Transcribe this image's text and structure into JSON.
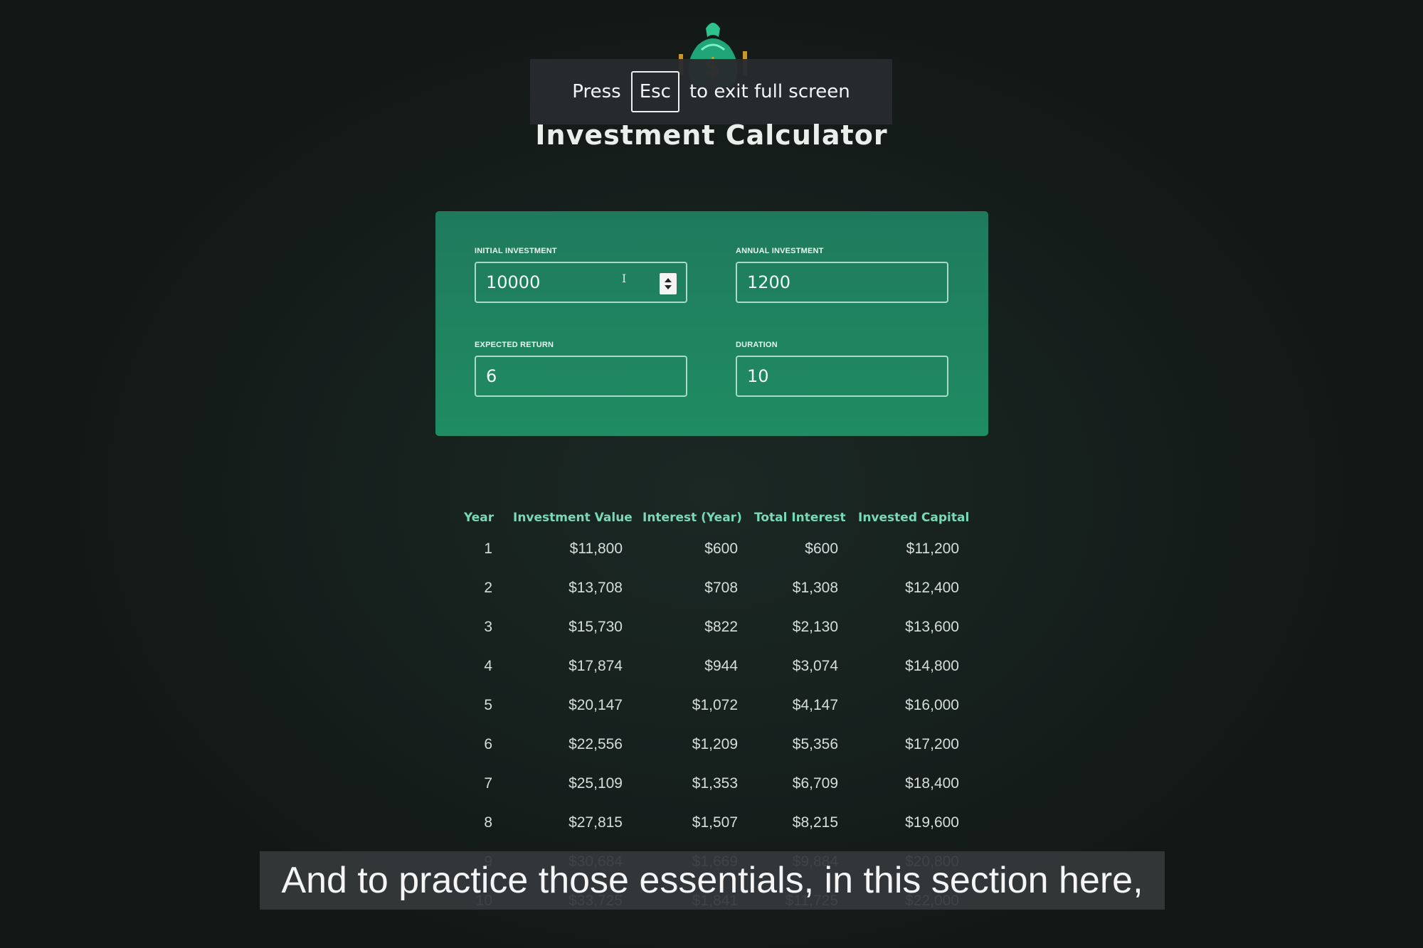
{
  "page": {
    "title": "Investment Calculator"
  },
  "logo": {
    "icon": "money-bag-icon"
  },
  "fullscreen_notice": {
    "press": "Press",
    "key": "Esc",
    "rest": "to exit full screen"
  },
  "inputs": {
    "initial_investment": {
      "label": "Initial Investment",
      "value": "10000"
    },
    "annual_investment": {
      "label": "Annual Investment",
      "value": "1200"
    },
    "expected_return": {
      "label": "Expected Return",
      "value": "6"
    },
    "duration": {
      "label": "Duration",
      "value": "10"
    }
  },
  "table": {
    "headers": [
      "Year",
      "Investment Value",
      "Interest (Year)",
      "Total Interest",
      "Invested Capital"
    ],
    "rows": [
      [
        "1",
        "$11,800",
        "$600",
        "$600",
        "$11,200"
      ],
      [
        "2",
        "$13,708",
        "$708",
        "$1,308",
        "$12,400"
      ],
      [
        "3",
        "$15,730",
        "$822",
        "$2,130",
        "$13,600"
      ],
      [
        "4",
        "$17,874",
        "$944",
        "$3,074",
        "$14,800"
      ],
      [
        "5",
        "$20,147",
        "$1,072",
        "$4,147",
        "$16,000"
      ],
      [
        "6",
        "$22,556",
        "$1,209",
        "$5,356",
        "$17,200"
      ],
      [
        "7",
        "$25,109",
        "$1,353",
        "$6,709",
        "$18,400"
      ],
      [
        "8",
        "$27,815",
        "$1,507",
        "$8,215",
        "$19,600"
      ],
      [
        "9",
        "$30,684",
        "$1,669",
        "$9,884",
        "$20,800"
      ],
      [
        "10",
        "$33,725",
        "$1,841",
        "$11,725",
        "$22,000"
      ]
    ]
  },
  "caption": {
    "text": "And to practice those essentials, in this section here,"
  },
  "colors": {
    "accent": "#1f8c63",
    "header_text": "#79d8b5",
    "background": "#16201d"
  }
}
